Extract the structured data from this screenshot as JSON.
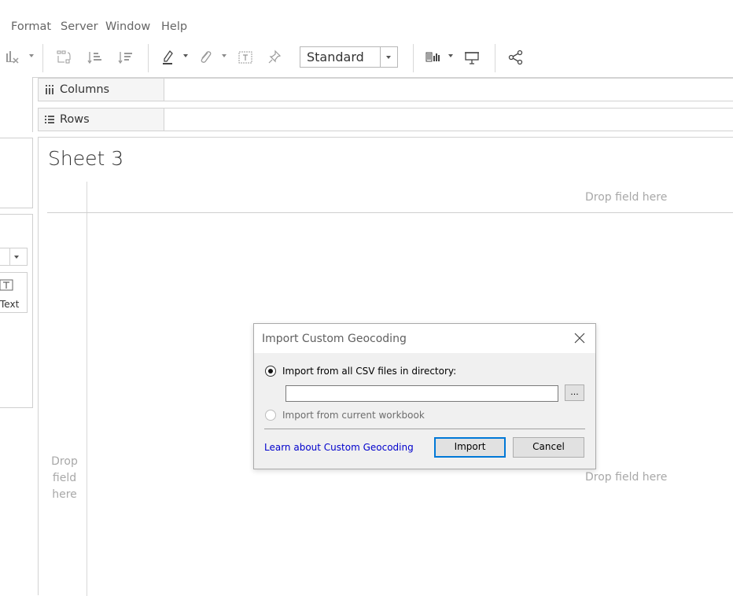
{
  "menu": {
    "items": [
      {
        "label": "Format"
      },
      {
        "label": "Server"
      },
      {
        "label": "Window"
      },
      {
        "label": "Help"
      }
    ]
  },
  "toolbar": {
    "fit_select_value": "Standard",
    "icons": [
      "clear-sheet-icon",
      "swap-icon",
      "sort-ascending-icon",
      "sort-descending-icon",
      "highlight-icon",
      "group-icon",
      "show-labels-icon",
      "fix-axes-icon",
      "show-me-icon",
      "presentation-icon",
      "share-icon"
    ]
  },
  "left_panel": {
    "marks_text_label": "Text"
  },
  "shelves": {
    "columns_label": "Columns",
    "rows_label": "Rows"
  },
  "view": {
    "sheet_title": "Sheet 3",
    "drop_top": "Drop field here",
    "drop_left": "Drop\nfield\nhere",
    "drop_right": "Drop field here"
  },
  "dialog": {
    "title": "Import Custom Geocoding",
    "option_directory": "Import from all CSV files in directory:",
    "option_workbook": "Import from current workbook",
    "path_value": "",
    "browse_label": "...",
    "learn_link": "Learn about Custom Geocoding",
    "import_label": "Import",
    "cancel_label": "Cancel",
    "selected_option": "directory"
  }
}
